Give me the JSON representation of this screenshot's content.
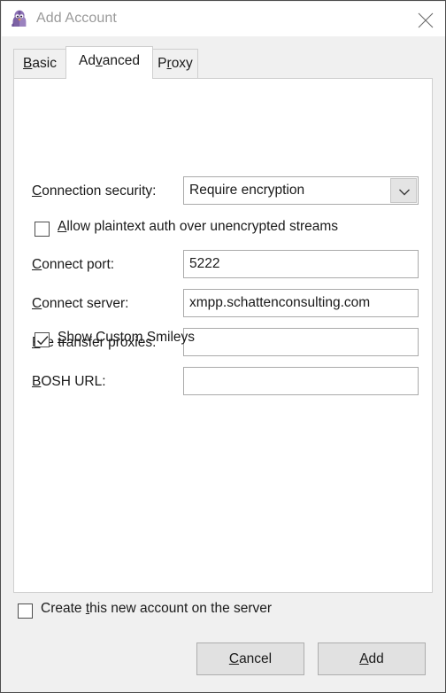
{
  "window": {
    "title": "Add Account",
    "icon": "pidgin-bird-icon",
    "close_icon": "close-icon",
    "title_color": "#9a9a9a",
    "frame_border_color": "#4d4d4d",
    "background": "#f0f0f0"
  },
  "tabs": [
    {
      "id": "basic",
      "label": "Basic",
      "mnemonic": "B",
      "selected": false
    },
    {
      "id": "advanced",
      "label": "Advanced",
      "mnemonic": "v",
      "selected": true
    },
    {
      "id": "proxy",
      "label": "Proxy",
      "mnemonic": "r",
      "selected": false
    }
  ],
  "form": {
    "connection_security": {
      "label": "Connection security:",
      "mnemonic": "C",
      "value": "Require encryption",
      "dropdown_icon": "chevron-down-icon",
      "options": [
        "Require encryption"
      ]
    },
    "allow_plaintext": {
      "label": "Allow plaintext auth over unencrypted streams",
      "mnemonic": "A",
      "checked": false
    },
    "connect_port": {
      "label": "Connect port:",
      "mnemonic": "C",
      "value": "5222",
      "placeholder": ""
    },
    "connect_server": {
      "label": "Connect server:",
      "mnemonic": "C",
      "value": "xmpp.schattenconsulting.com",
      "placeholder": ""
    },
    "file_transfer_proxies": {
      "label": "File transfer proxies:",
      "mnemonic": "F",
      "value": "",
      "placeholder": ""
    },
    "bosh_url": {
      "label": "BOSH URL:",
      "mnemonic": "B",
      "value": "",
      "placeholder": ""
    },
    "show_custom_smileys": {
      "label": "Show Custom Smileys",
      "mnemonic": "S",
      "checked": true
    }
  },
  "footer": {
    "create_account": {
      "label": "Create this new account on the server",
      "mnemonic": "t",
      "checked": false
    },
    "cancel_label": "Cancel",
    "cancel_mnemonic": "C",
    "add_label": "Add",
    "add_mnemonic": "A"
  }
}
